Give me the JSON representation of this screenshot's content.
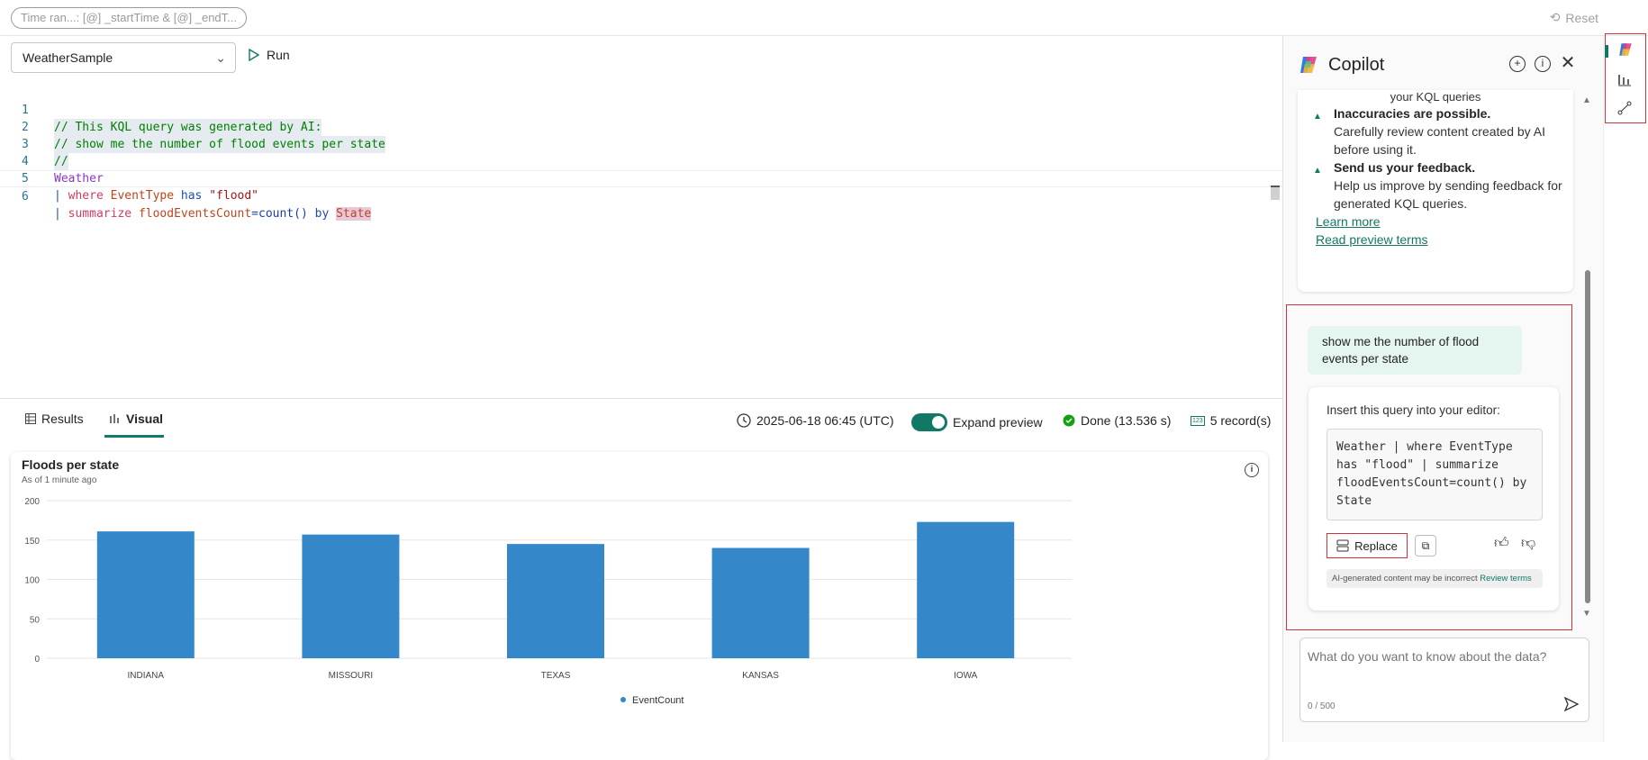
{
  "topbar": {
    "time_range": "Time ran...: [@] _startTime  & [@] _endT...",
    "reset_label": "Reset"
  },
  "editor": {
    "database": "WeatherSample",
    "run_label": "Run",
    "line_numbers": [
      "1",
      "2",
      "3",
      "4",
      "5",
      "6"
    ],
    "lines": {
      "l1": "// This KQL query was generated by AI:",
      "l2": "// show me the number of flood events per state",
      "l3": "//",
      "l4": "Weather",
      "l5_pipe": "| ",
      "l5_kw": "where",
      "l5_field": "EventType",
      "l5_op": "has",
      "l5_str": "\"flood\"",
      "l6_pipe": "| ",
      "l6_kw": "summarize",
      "l6_field": "floodEventsCount",
      "l6_eq": "=",
      "l6_fn": "count()",
      "l6_by": "by",
      "l6_state": "State"
    }
  },
  "results": {
    "tab_results": "Results",
    "tab_visual": "Visual",
    "timestamp": "2025-06-18 06:45 (UTC)",
    "expand_preview": "Expand preview",
    "done": "Done (13.536 s)",
    "records": "5 record(s)",
    "records_icon_text": "123"
  },
  "chart": {
    "title": "Floods per state",
    "subtitle": "As of 1 minute ago",
    "info_glyph": "i",
    "legend": "EventCount"
  },
  "chart_data": {
    "type": "bar",
    "title": "Floods per state",
    "categories": [
      "INDIANA",
      "MISSOURI",
      "TEXAS",
      "KANSAS",
      "IOWA"
    ],
    "series": [
      {
        "name": "EventCount",
        "values": [
          161,
          157,
          145,
          140,
          173
        ]
      }
    ],
    "y_ticks": [
      0,
      50,
      100,
      150,
      200
    ],
    "ylim": [
      0,
      200
    ],
    "grid": true,
    "legend_position": "bottom",
    "bar_color": "#3488c9"
  },
  "copilot": {
    "title": "Copilot",
    "intro_tail": "your KQL queries",
    "item1_title": "Inaccuracies are possible.",
    "item1_body": "Carefully review content created by AI before using it.",
    "item2_title": "Send us your feedback.",
    "item2_body": "Help us improve by sending feedback for generated KQL queries.",
    "learn_more": "Learn more",
    "preview_terms": "Read preview terms",
    "user_message": "show me the number of flood events per state",
    "answer_label": "Insert this query into your editor:",
    "answer_code": "Weather | where EventType has \"flood\" | summarize floodEventsCount=count() by State",
    "replace_label": "Replace",
    "ai_note": "AI-generated content may be incorrect ",
    "ai_note_link": "Review terms",
    "ask_placeholder": "What do you want to know about the data?",
    "char_count": "0 / 500"
  },
  "colors": {
    "accent": "#117865",
    "highlight_border": "#d13438",
    "bar": "#3488c9"
  },
  "icons": [
    "reset-icon",
    "chevron-down-icon",
    "play-icon",
    "table-icon",
    "chart-icon",
    "clock-icon",
    "check-circle-icon",
    "records-icon",
    "info-icon",
    "copilot-logo-icon",
    "new-chat-icon",
    "close-icon",
    "replace-icon",
    "copy-icon",
    "thumbs-up-icon",
    "thumbs-down-icon",
    "send-icon",
    "rail-copilot-icon",
    "rail-chart-icon",
    "rail-share-icon"
  ]
}
